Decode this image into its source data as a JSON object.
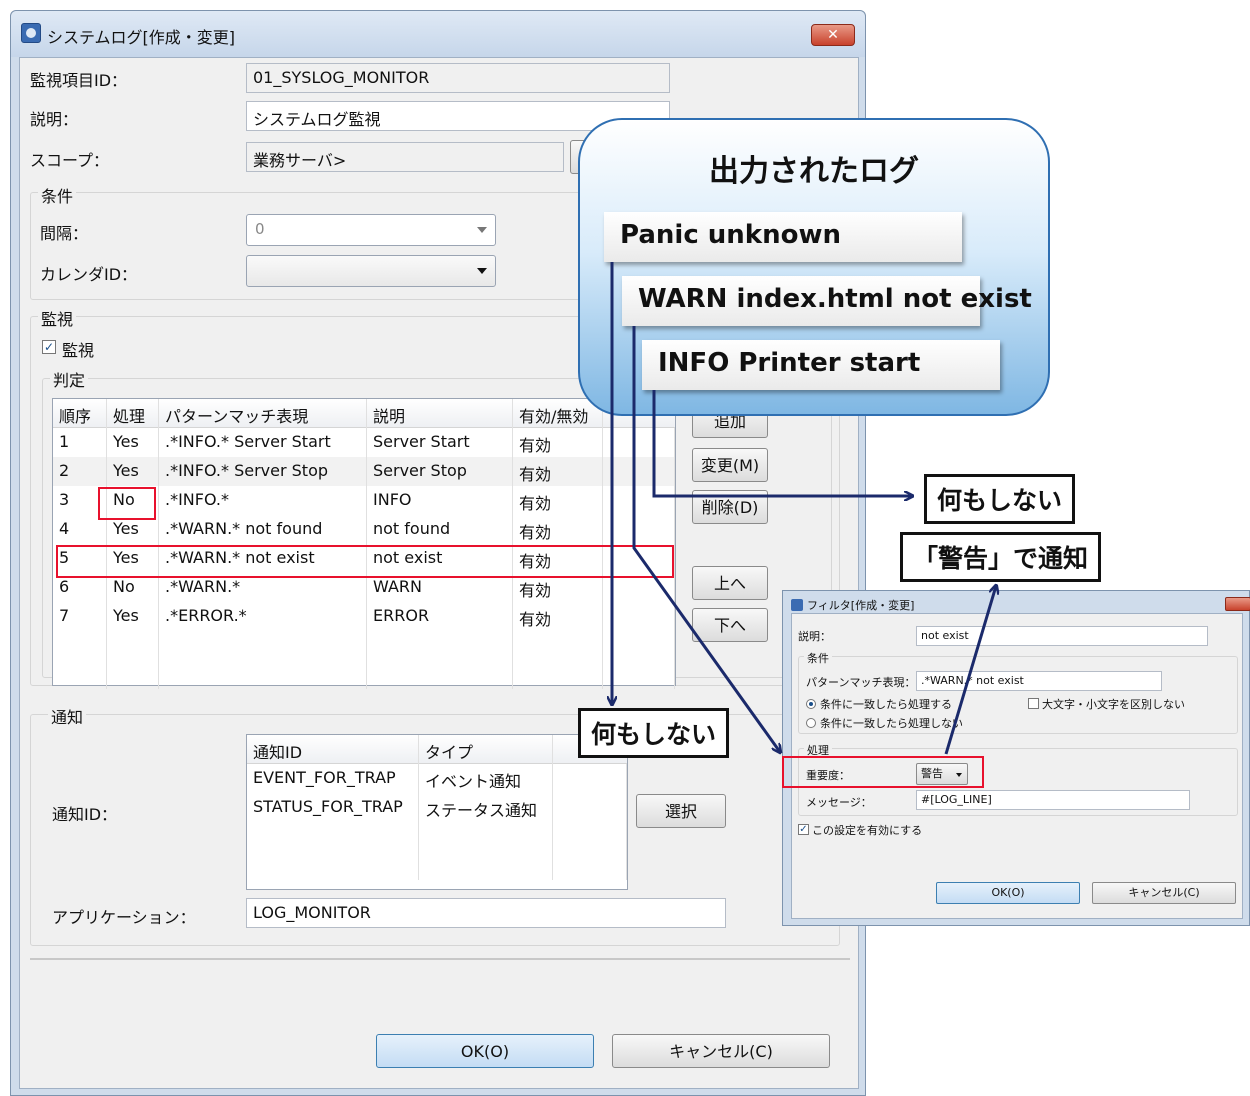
{
  "main_dialog": {
    "title": "システムログ[作成・変更]",
    "close_label": "✕",
    "monitor_id_label": "監視項目ID：",
    "monitor_id_value": "01_SYSLOG_MONITOR",
    "description_label": "説明：",
    "description_value": "システムログ監視",
    "scope_label": "スコープ：",
    "scope_value": "業務サーバ>",
    "condition_group": "条件",
    "interval_label": "間隔：",
    "interval_value": "0",
    "calendar_label": "カレンダID：",
    "calendar_value": "",
    "monitor_group": "監視",
    "monitor_check_label": "監視",
    "judge_group": "判定",
    "table_headers": [
      "順序",
      "処理",
      "パターンマッチ表現",
      "説明",
      "有効/無効"
    ],
    "rows": [
      [
        "1",
        "Yes",
        ".*INFO.* Server Start",
        "Server Start",
        "有効"
      ],
      [
        "2",
        "Yes",
        ".*INFO.* Server Stop",
        "Server Stop",
        "有効"
      ],
      [
        "3",
        "No",
        ".*INFO.*",
        "INFO",
        "有効"
      ],
      [
        "4",
        "Yes",
        ".*WARN.* not found",
        "not found",
        "有効"
      ],
      [
        "5",
        "Yes",
        ".*WARN.* not exist",
        "not exist",
        "有効"
      ],
      [
        "6",
        "No",
        ".*WARN.*",
        "WARN",
        "有効"
      ],
      [
        "7",
        "Yes",
        ".*ERROR.*",
        "ERROR",
        "有効"
      ]
    ],
    "add_button": "追加",
    "modify_button": "変更(M)",
    "delete_button": "削除(D)",
    "up_button": "上へ",
    "down_button": "下へ",
    "notify_group": "通知",
    "notify_id_label": "通知ID：",
    "notify_headers": [
      "通知ID",
      "タイプ"
    ],
    "notify_rows": [
      [
        "EVENT_FOR_TRAP",
        "イベント通知"
      ],
      [
        "STATUS_FOR_TRAP",
        "ステータス通知"
      ]
    ],
    "select_button": "選択",
    "application_label": "アプリケーション：",
    "application_value": "LOG_MONITOR",
    "ok_button": "OK(O)",
    "cancel_button": "キャンセル(C)"
  },
  "log_bubble": {
    "title": "出力されたログ",
    "lines": [
      "Panic unknown",
      "WARN index.html not exist",
      "INFO Printer start"
    ]
  },
  "callouts": {
    "do_nothing_1": "何もしない",
    "notify_warning": "「警告」で通知",
    "do_nothing_2": "何もしない"
  },
  "filter_dialog": {
    "title": "フィルタ[作成・変更]",
    "description_label": "説明：",
    "description_value": "not exist",
    "condition_group": "条件",
    "pattern_label": "パターンマッチ表現：",
    "pattern_value": ".*WARN.* not exist",
    "radio_match": "条件に一致したら処理する",
    "radio_nomatch": "条件に一致したら処理しない",
    "case_label": "大文字・小文字を区別しない",
    "process_group": "処理",
    "priority_label": "重要度：",
    "priority_value": "警告",
    "message_label": "メッセージ：",
    "message_value": "#[LOG_LINE]",
    "enable_label": "この設定を有効にする",
    "ok_button": "OK(O)",
    "cancel_button": "キャンセル(C)"
  },
  "colors": {
    "highlight_red": "#e8112d",
    "arrow_navy": "#1b2a6b",
    "bubble_blue": "#7fb7e3"
  }
}
